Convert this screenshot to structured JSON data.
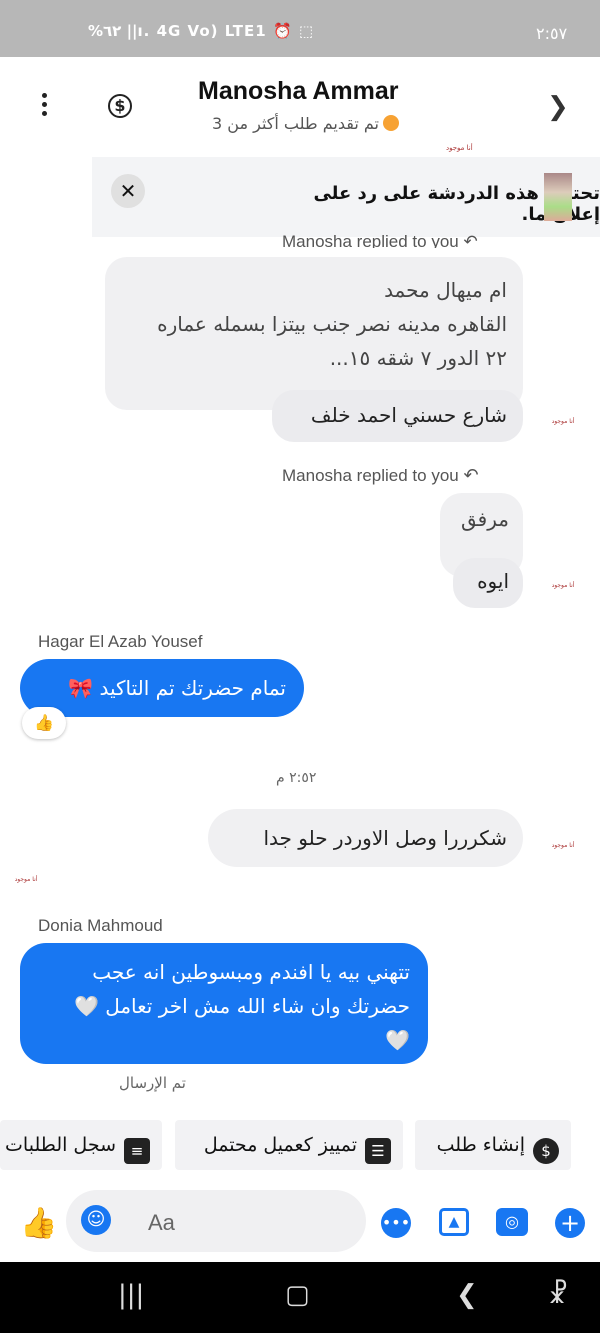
{
  "status_bar": {
    "time": "٢:٥٧",
    "icons_text": "%٦٢ ||ı. 4G Vo) LTE1 ⏰ ⬚"
  },
  "header": {
    "contact_name": "Manosha Ammar",
    "subtitle": "تم تقديم طلب  أكثر من 3",
    "avatar_text": "أنا موجود"
  },
  "ad_banner": {
    "text": "تحتوي هذه الدردشة على رد على إعلان ما.",
    "close_label": "✕"
  },
  "messages": {
    "reply_header_top": "Manosha replied to you",
    "m1_quote_lines": [
      "ام ميهال محمد",
      "القاهره مدينه نصر جنب بيتزا بسمله عماره",
      "٢٢ الدور ٧ شقه ١٥..."
    ],
    "m1_reply": "شارع حسني احمد خلف",
    "reply_header_2": "Manosha replied to you",
    "m2_quote": "مرفق",
    "m2_reply": "ايوه",
    "sender_1": "Hagar El Azab Yousef",
    "m3_text": "تمام حضرتك تم التاكيد 🎀",
    "m3_reaction": "👍",
    "timestamp": "٢:٥٢ م",
    "m4_text": "شكرررا وصل الاوردر حلو جدا",
    "sender_2": "Donia Mahmoud",
    "m5_lines": [
      "تتهني بيه يا افندم ومبسوطين انه عجب",
      "حضرتك وان شاء الله مش اخر تعامل 🤍",
      "🤍"
    ],
    "sent_status": "تم الإرسال"
  },
  "quick_actions": [
    {
      "label": "إنشاء طلب",
      "icon": "dollar-icon"
    },
    {
      "label": "تمييز كعميل محتمل",
      "icon": "contact-card-icon"
    },
    {
      "label": "سجل الطلبات",
      "icon": "list-icon"
    }
  ],
  "composer": {
    "placeholder": "Aa"
  },
  "colors": {
    "accent": "#1877f2",
    "bubble_gray": "#f0f0f2",
    "status_bar": "#b7b7b7"
  }
}
